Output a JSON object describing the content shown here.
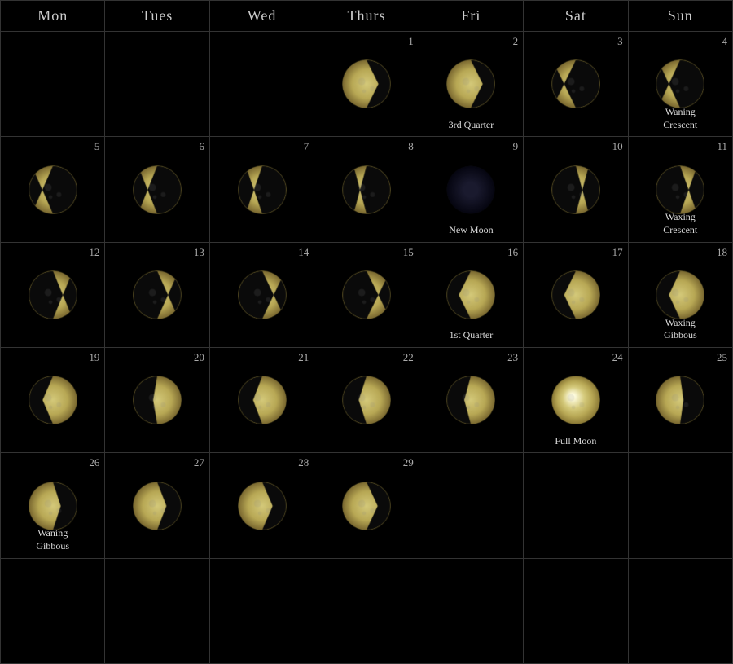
{
  "headers": [
    "Mon",
    "Tues",
    "Wed",
    "Thurs",
    "Fri",
    "Sat",
    "Sun"
  ],
  "days": [
    {
      "num": null,
      "phase": null,
      "label": null
    },
    {
      "num": null,
      "phase": null,
      "label": null
    },
    {
      "num": null,
      "phase": null,
      "label": null
    },
    {
      "num": "1",
      "phase": "waning_crescent_late",
      "label": null
    },
    {
      "num": "2",
      "phase": "third_quarter",
      "label": "3rd Quarter"
    },
    {
      "num": "3",
      "phase": "waning_crescent2",
      "label": null
    },
    {
      "num": "4",
      "phase": "waning_crescent3",
      "label": "Waning\nCrescent"
    },
    {
      "num": "5",
      "phase": "waning_crescent4",
      "label": null
    },
    {
      "num": "6",
      "phase": "waning_crescent5",
      "label": null
    },
    {
      "num": "7",
      "phase": "waning_crescent6",
      "label": null
    },
    {
      "num": "8",
      "phase": "waning_crescent7",
      "label": null
    },
    {
      "num": "9",
      "phase": "new_moon",
      "label": "New Moon"
    },
    {
      "num": "10",
      "phase": "waxing_crescent1",
      "label": null
    },
    {
      "num": "11",
      "phase": "waxing_crescent2",
      "label": "Waxing\nCrescent"
    },
    {
      "num": "12",
      "phase": "waxing_crescent3",
      "label": null
    },
    {
      "num": "13",
      "phase": "waxing_crescent4",
      "label": null
    },
    {
      "num": "14",
      "phase": "waxing_crescent5",
      "label": null
    },
    {
      "num": "15",
      "phase": "first_quarter_pre",
      "label": null
    },
    {
      "num": "16",
      "phase": "first_quarter",
      "label": "1st Quarter"
    },
    {
      "num": "17",
      "phase": "waxing_gibbous1",
      "label": null
    },
    {
      "num": "18",
      "phase": "waxing_gibbous2",
      "label": "Waxing\nGibbous"
    },
    {
      "num": "19",
      "phase": "waxing_gibbous3",
      "label": null
    },
    {
      "num": "20",
      "phase": "full_moon_pre",
      "label": null
    },
    {
      "num": "21",
      "phase": "waxing_gibbous4",
      "label": null
    },
    {
      "num": "22",
      "phase": "waxing_gibbous5",
      "label": null
    },
    {
      "num": "23",
      "phase": "waxing_gibbous6",
      "label": null
    },
    {
      "num": "24",
      "phase": "full_moon",
      "label": "Full Moon"
    },
    {
      "num": "25",
      "phase": "full_moon2",
      "label": null
    },
    {
      "num": "26",
      "phase": "waning_gibbous1",
      "label": "Waning\nGibbous"
    },
    {
      "num": "27",
      "phase": "waning_gibbous2",
      "label": null
    },
    {
      "num": "28",
      "phase": "waning_gibbous3",
      "label": null
    },
    {
      "num": "29",
      "phase": "waning_gibbous4",
      "label": null
    },
    {
      "num": null,
      "phase": null,
      "label": null
    },
    {
      "num": null,
      "phase": null,
      "label": null
    },
    {
      "num": null,
      "phase": null,
      "label": null
    },
    {
      "num": null,
      "phase": null,
      "label": null
    },
    {
      "num": null,
      "phase": null,
      "label": null
    },
    {
      "num": null,
      "phase": null,
      "label": null
    },
    {
      "num": null,
      "phase": null,
      "label": null
    },
    {
      "num": null,
      "phase": null,
      "label": null
    },
    {
      "num": null,
      "phase": null,
      "label": null
    },
    {
      "num": null,
      "phase": null,
      "label": null
    }
  ]
}
